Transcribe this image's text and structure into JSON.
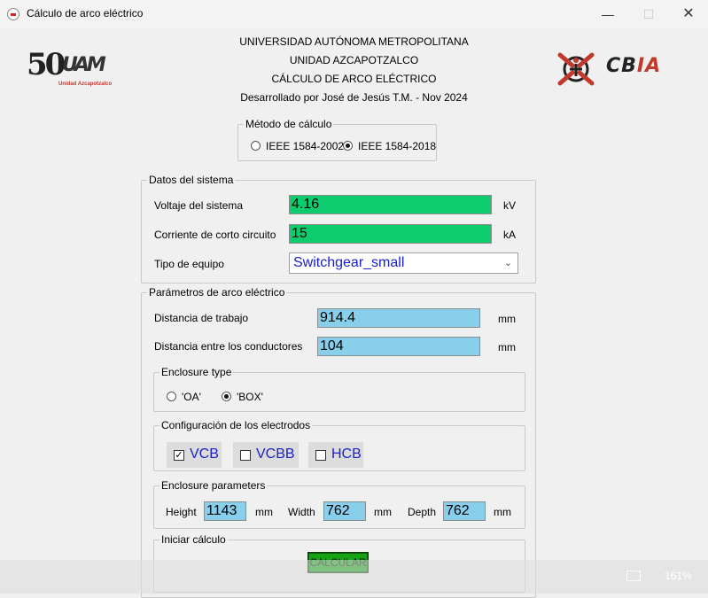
{
  "window": {
    "title": "Cálculo de arco eléctrico",
    "minimize": "—",
    "maximize": "☐",
    "close": "✕"
  },
  "header": {
    "line1": "UNIVERSIDAD AUTÓNOMA METROPOLITANA",
    "line2": "UNIDAD AZCAPOTZALCO",
    "line3": "CÁLCULO DE ARCO ELÉCTRICO",
    "line4": "Desarrollado por José de Jesús T.M. - Nov 2024"
  },
  "logos": {
    "left_big": "50",
    "left_mark": "UAM",
    "left_sub": "Unidad Azcapotzalco",
    "right_text_a": "CB",
    "right_text_b": "IA"
  },
  "metodo": {
    "title": "Método de cálculo",
    "options": [
      "IEEE 1584-2002",
      "IEEE 1584-2018"
    ],
    "selected": "IEEE 1584-2018"
  },
  "datos": {
    "title": "Datos del sistema",
    "voltaje_label": "Voltaje del sistema",
    "voltaje_value": "4.16",
    "voltaje_unit": "kV",
    "corriente_label": "Corriente de corto circuito",
    "corriente_value": "15",
    "corriente_unit": "kA",
    "equipo_label": "Tipo de equipo",
    "equipo_value": "Switchgear_small"
  },
  "parametros": {
    "title": "Parámetros de arco eléctrico",
    "distancia_trabajo_label": "Distancia de trabajo",
    "distancia_trabajo_value": "914.4",
    "distancia_trabajo_unit": "mm",
    "distancia_conductores_label": "Distancia entre los conductores",
    "distancia_conductores_value": "104",
    "distancia_conductores_unit": "mm"
  },
  "enclosure_type": {
    "title": "Enclosure type",
    "options": [
      "'OA'",
      "'BOX'"
    ],
    "selected": "'BOX'"
  },
  "electrodos": {
    "title": "Configuración de los electrodos",
    "options": [
      {
        "label": "VCB",
        "checked": true,
        "mark": "✓"
      },
      {
        "label": "VCBB",
        "checked": false,
        "mark": ""
      },
      {
        "label": "HCB",
        "checked": false,
        "mark": ""
      }
    ]
  },
  "enclosure_params": {
    "title": "Enclosure parameters",
    "height_label": "Height",
    "height_value": "1143",
    "width_label": "Width",
    "width_value": "762",
    "depth_label": "Depth",
    "depth_value": "762",
    "unit": "mm"
  },
  "calculo": {
    "title": "Iniciar cálculo",
    "button": "CALCULAR"
  },
  "overlay": {
    "zoom": "161%"
  },
  "colors": {
    "green_field": "#0dcc6e",
    "blue_field": "#88cfec",
    "button_green": "#13a313",
    "label_blue": "#1a21c8",
    "brand_red": "#c0392b"
  }
}
